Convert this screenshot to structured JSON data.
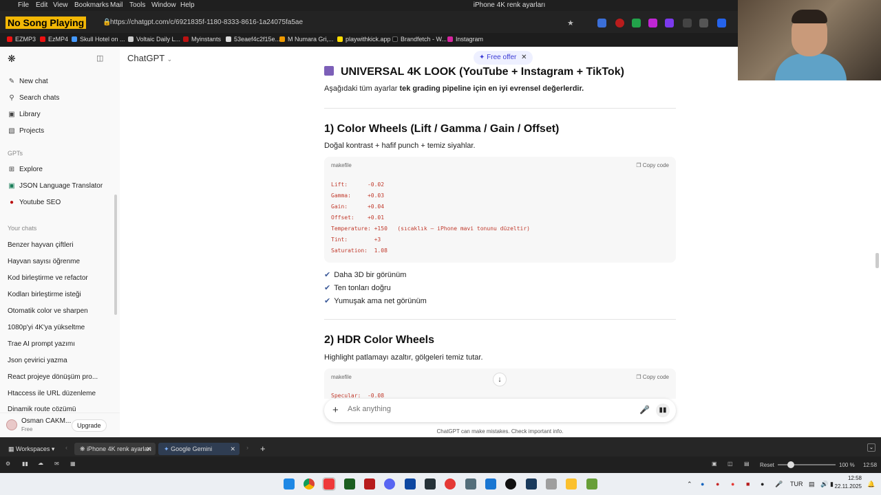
{
  "menubar": {
    "items": [
      "File",
      "Edit",
      "View",
      "Bookmarks",
      "Mail",
      "Tools",
      "Window",
      "Help"
    ],
    "window_title": "iPhone 4K renk ayarları"
  },
  "browser": {
    "now_playing": "No Song Playing",
    "url": "https://chatgpt.com/c/6921835f-1180-8333-8616-1a24075fa5ae",
    "bookmarks": [
      "EZMP3",
      "EzMP4",
      "Skull Hotel on ...",
      "Voltaic Daily L...",
      "Myinstants",
      "53eaef4c2f15e...",
      "M Numara Gri,...",
      "playwithkick.app",
      "Brandfetch - W...",
      "Instagram"
    ]
  },
  "sidebar": {
    "nav": [
      "New chat",
      "Search chats",
      "Library",
      "Projects"
    ],
    "gpts_header": "GPTs",
    "gpts": [
      "Explore",
      "JSON Language Translator",
      "Youtube SEO"
    ],
    "chats_header": "Your chats",
    "chats": [
      "Benzer hayvan çiftleri",
      "Hayvan sayısı öğrenme",
      "Kod birleştirme ve refactor",
      "Kodları birleştirme isteği",
      "Otomatik color ve sharpen",
      "1080p'yi 4K'ya yükseltme",
      "Trae AI prompt yazımı",
      "Json çevirici yazma",
      "React projeye dönüşüm pro...",
      "Htaccess ile URL düzenleme",
      "Dinamik route çözümü"
    ],
    "user": {
      "name": "Osman CAKM...",
      "plan": "Free",
      "upgrade": "Upgrade"
    }
  },
  "header": {
    "model": "ChatGPT",
    "offer": "Free offer"
  },
  "content": {
    "section_title": "UNIVERSAL 4K LOOK (YouTube + Instagram + TikTok)",
    "intro_prefix": "Aşağıdaki tüm ayarlar ",
    "intro_bold": "tek grading pipeline için en iyi evrensel değerlerdir.",
    "s1_title": "1)  Color Wheels (Lift / Gamma / Gain / Offset)",
    "s1_desc": "Doğal kontrast + hafif punch + temiz siyahlar.",
    "code1_lang": "makefile",
    "copy_label": "Copy code",
    "code1_lines": [
      "Lift:      -0.02",
      "Gamma:     +0.03",
      "Gain:      +0.04",
      "Offset:    +0.01",
      "Temperature: +150   (sıcaklık – iPhone mavi tonunu düzeltir)",
      "Tint:        +3",
      "Saturation:  1.08"
    ],
    "checks": [
      "Daha 3D bir görünüm",
      "Ten tonları doğru",
      "Yumuşak ama net görünüm"
    ],
    "s2_title": "2)  HDR Color Wheels",
    "s2_desc": "Highlight patlamayı azaltır, gölgeleri temiz tutar.",
    "code2_lang": "makefile",
    "code2_first": "Specular:  -0.08"
  },
  "composer": {
    "placeholder": "Ask anything",
    "disclaimer": "ChatGPT can make mistakes. Check important info."
  },
  "tabbar": {
    "workspaces": "Workspaces",
    "tabs": [
      "iPhone 4K renk ayarları",
      "Google Gemini"
    ]
  },
  "statusbar": {
    "reset": "Reset",
    "zoom": "100 %",
    "time": "12:58"
  },
  "taskbar": {
    "lang": "TUR",
    "time": "12:58",
    "date": "22.11.2025"
  },
  "colors": {
    "accent": "#3b3bd6",
    "code_text": "#c0392b",
    "now_playing_bg": "#f2b705"
  }
}
